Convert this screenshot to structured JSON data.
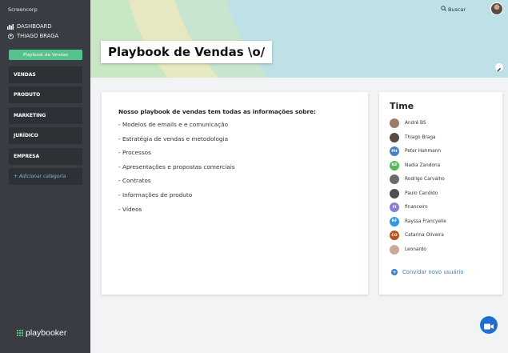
{
  "sidebar": {
    "company": "Screencorp",
    "dashboard_label": "DASHBOARD",
    "user_label": "THIAGO BRAGA",
    "playbook_button": "Playbook de Vendas",
    "categories": [
      "VENDAS",
      "PRODUTO",
      "MARKETING",
      "JURÍDICO",
      "EMPRESA"
    ],
    "add_category": "+ Adicionar categoria",
    "logo_text": "playbooker",
    "accent_color": "#55c18b"
  },
  "header": {
    "title": "Playbook de Vendas \\o/",
    "search_label": "Buscar"
  },
  "content": {
    "intro": "Nosso playbook de vendas tem todas as informações sobre:",
    "lines": [
      "- Modelos de emails e e comunicação",
      "- Estratégia de vendas e metodologia",
      "- Processos",
      "- Apresentações e propostas comerciais",
      "- Contratos",
      "- Informações de produto",
      "- Vídeos"
    ]
  },
  "team": {
    "title": "Time",
    "members": [
      {
        "name": "André BS",
        "initials": "",
        "color": "#9b7b66"
      },
      {
        "name": "Thiago Braga",
        "initials": "",
        "color": "#5a4a44"
      },
      {
        "name": "Peter Hahmann",
        "initials": "PH",
        "color": "#4a7fc1"
      },
      {
        "name": "Nadia Zandona",
        "initials": "NZ",
        "color": "#55b85a"
      },
      {
        "name": "Rodrigo Carvalho",
        "initials": "",
        "color": "#6b6b6b"
      },
      {
        "name": "Paulo Candido",
        "initials": "",
        "color": "#4e4e52"
      },
      {
        "name": "financeiro",
        "initials": "FI",
        "color": "#8a7fd6"
      },
      {
        "name": "Rayssa Francyelle",
        "initials": "RF",
        "color": "#2e9be0"
      },
      {
        "name": "Catarina Oliveira",
        "initials": "CO",
        "color": "#b5541f"
      },
      {
        "name": "Leonardo",
        "initials": "",
        "color": "#c9a99b"
      }
    ],
    "invite_label": "Convidar novo usuário"
  }
}
